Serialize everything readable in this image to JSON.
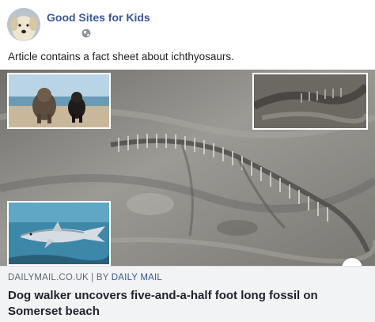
{
  "post": {
    "page_name": "Good Sites for Kids",
    "caption": "Article contains a fact sheet about ichthyosaurs.",
    "privacy_icon": "globe-icon"
  },
  "link_preview": {
    "domain": "DAILYMAIL.CO.UK",
    "separator": "|",
    "by_label": "BY",
    "author": "DAILY MAIL",
    "headline": "Dog walker uncovers five-and-a-half foot long fossil on Somerset beach"
  },
  "colors": {
    "page_name": "#385898",
    "meta_background": "#f2f3f5",
    "headline": "#1d2129",
    "source_text": "#606770"
  }
}
